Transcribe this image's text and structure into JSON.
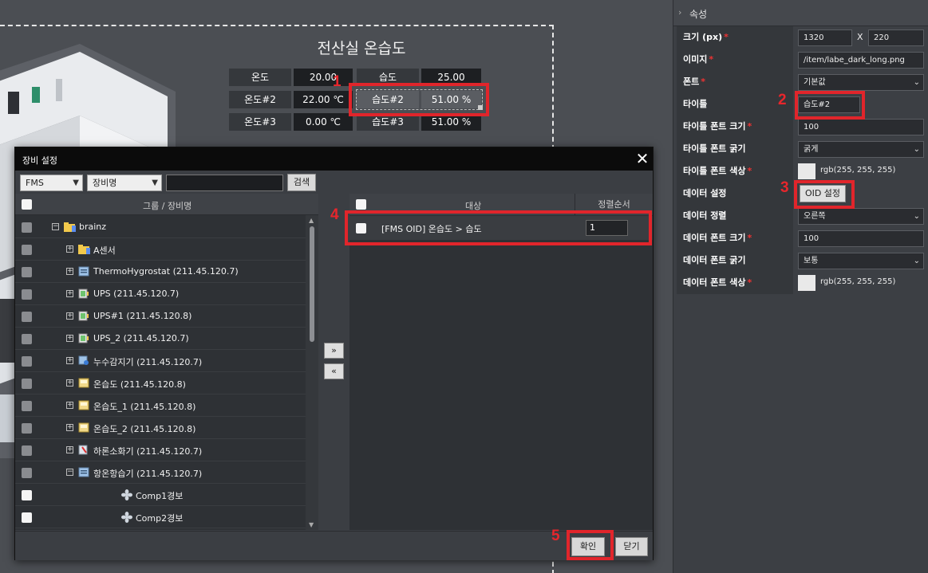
{
  "widget": {
    "title": "전산실 온습도",
    "rows": [
      {
        "l1": "온도",
        "v1": "20.00",
        "l2": "습도",
        "v2": "25.00"
      },
      {
        "l1": "온도#2",
        "v1": "22.00 ℃",
        "l2": "습도#2",
        "v2": "51.00 %"
      },
      {
        "l1": "온도#3",
        "v1": "0.00 ℃",
        "l2": "습도#3",
        "v2": "51.00 %"
      }
    ]
  },
  "steps": [
    "1",
    "2",
    "3",
    "4",
    "5"
  ],
  "dialog": {
    "title": "장비 설정",
    "filter_type": "FMS",
    "filter_field": "장비명",
    "search_value": "",
    "search_label": "검색",
    "left_header": "그룹 / 장비명",
    "tree": [
      {
        "label": "brainz",
        "level": 0,
        "toggle": "−",
        "icon": "folder"
      },
      {
        "label": "A센서",
        "level": 1,
        "toggle": "+",
        "icon": "folder"
      },
      {
        "label": "ThermoHygrostat (211.45.120.7)",
        "level": 1,
        "toggle": "+",
        "icon": "device"
      },
      {
        "label": "UPS (211.45.120.7)",
        "level": 1,
        "toggle": "+",
        "icon": "battery"
      },
      {
        "label": "UPS#1 (211.45.120.8)",
        "level": 1,
        "toggle": "+",
        "icon": "battery"
      },
      {
        "label": "UPS_2 (211.45.120.7)",
        "level": 1,
        "toggle": "+",
        "icon": "battery"
      },
      {
        "label": "누수감지기 (211.45.120.7)",
        "level": 1,
        "toggle": "+",
        "icon": "leak"
      },
      {
        "label": "온습도 (211.45.120.8)",
        "level": 1,
        "toggle": "+",
        "icon": "sensor"
      },
      {
        "label": "온습도_1 (211.45.120.8)",
        "level": 1,
        "toggle": "+",
        "icon": "sensor"
      },
      {
        "label": "온습도_2 (211.45.120.8)",
        "level": 1,
        "toggle": "+",
        "icon": "sensor"
      },
      {
        "label": "하론소화기 (211.45.120.7)",
        "level": 1,
        "toggle": "+",
        "icon": "extinguisher"
      },
      {
        "label": "항온항습기 (211.45.120.7)",
        "level": 1,
        "toggle": "−",
        "icon": "device"
      },
      {
        "label": "Comp1경보",
        "level": 2,
        "toggle": "",
        "icon": "fan"
      },
      {
        "label": "Comp2경보",
        "level": 2,
        "toggle": "",
        "icon": "fan"
      }
    ],
    "move_right": "»",
    "move_left": "«",
    "right_header_target": "대상",
    "right_header_order": "정렬순서",
    "selected_item": "[FMS OID] 온습도 > 습도",
    "selected_order": "1",
    "confirm_label": "확인",
    "close_label": "닫기"
  },
  "props": {
    "section_label": "속성",
    "size_label": "크기 (px)",
    "width": "1320",
    "size_sep": "X",
    "height": "220",
    "image_label": "이미지",
    "image": "/item/labe_dark_long.png",
    "font_label": "폰트",
    "font": "기본값",
    "title_label": "타이틀",
    "title": "습도#2",
    "title_font_size_label": "타이틀 폰트 크기",
    "title_font_size": "100",
    "title_font_weight_label": "타이틀 폰트 굵기",
    "title_font_weight": "굵게",
    "title_font_color_label": "타이틀 폰트 색상",
    "title_font_color": "rgb(255, 255, 255)",
    "data_setting_label": "데이터 설정",
    "oid_button": "OID 설정",
    "data_align_label": "데이터 정렬",
    "data_align": "오른쪽",
    "data_font_size_label": "데이터 폰트 크기",
    "data_font_size": "100",
    "data_font_weight_label": "데이터 폰트 굵기",
    "data_font_weight": "보통",
    "data_font_color_label": "데이터 폰트 색상",
    "data_font_color": "rgb(255, 255, 255)"
  }
}
